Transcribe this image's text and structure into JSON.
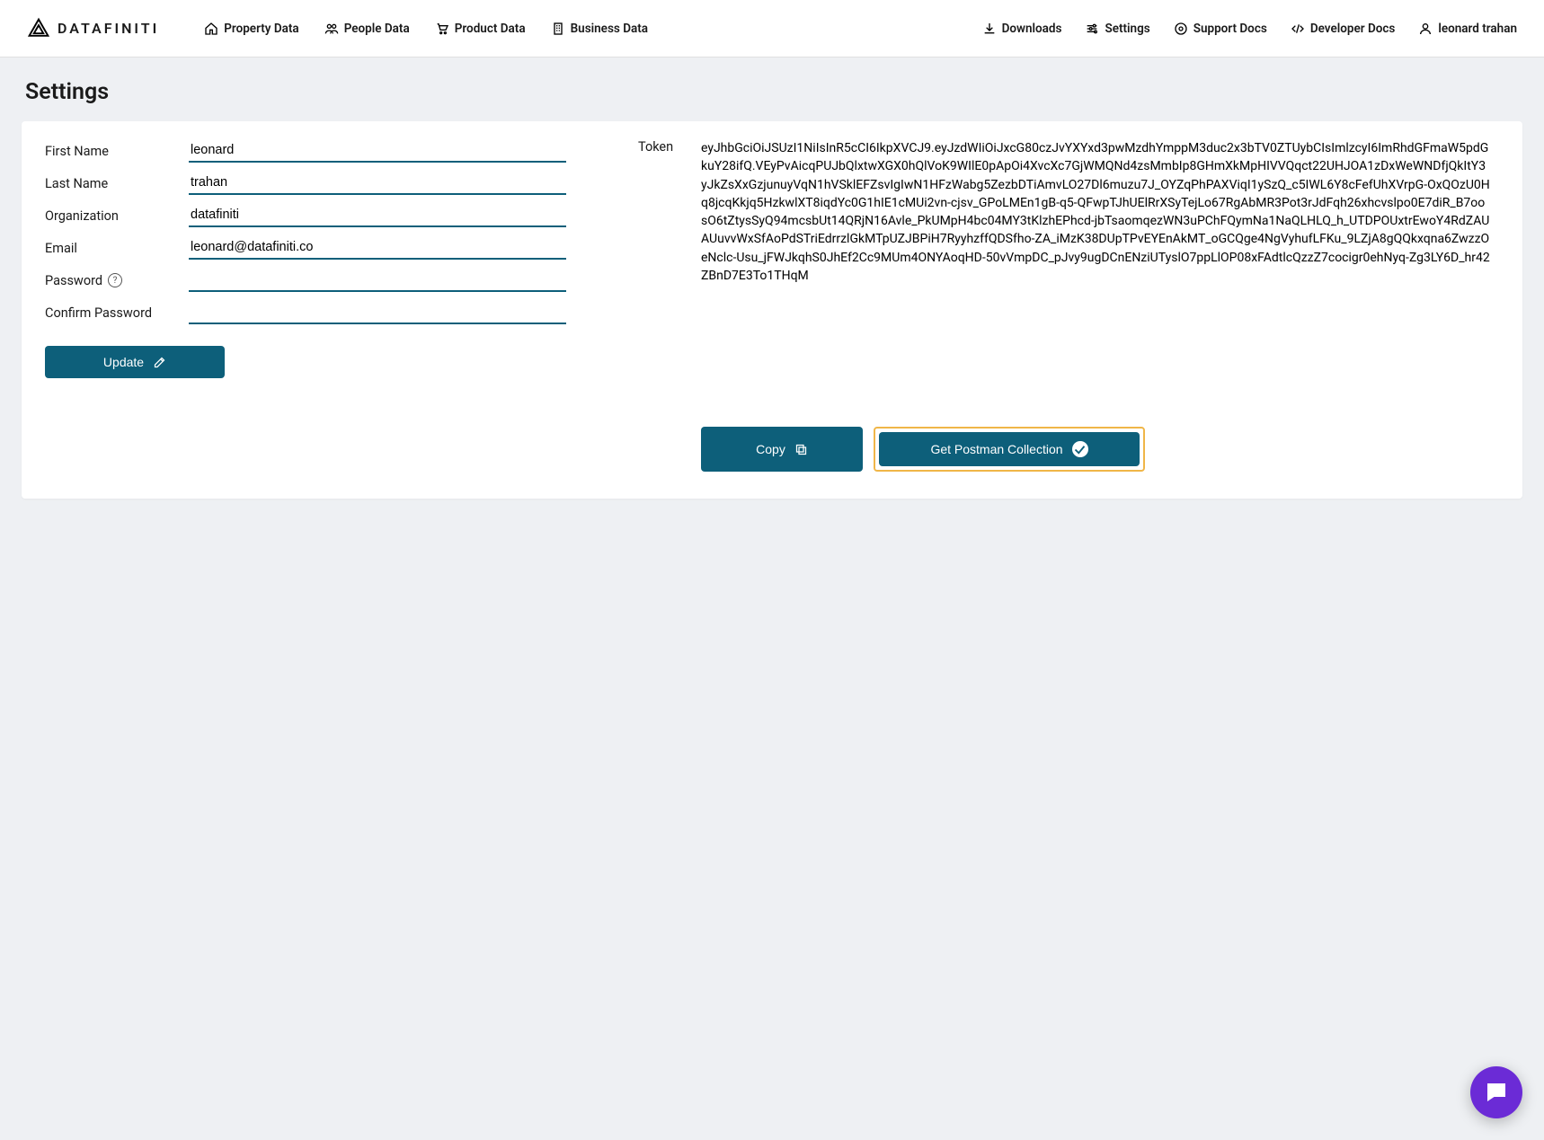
{
  "brand": "DATAFINITI",
  "nav": {
    "property": "Property Data",
    "people": "People Data",
    "product": "Product Data",
    "business": "Business Data",
    "downloads": "Downloads",
    "settings": "Settings",
    "support": "Support Docs",
    "developer": "Developer Docs",
    "user": "leonard trahan"
  },
  "page": {
    "title": "Settings"
  },
  "form": {
    "firstName": {
      "label": "First Name",
      "value": "leonard"
    },
    "lastName": {
      "label": "Last Name",
      "value": "trahan"
    },
    "organization": {
      "label": "Organization",
      "value": "datafiniti"
    },
    "email": {
      "label": "Email",
      "value": "leonard@datafiniti.co"
    },
    "password": {
      "label": "Password",
      "value": ""
    },
    "confirm": {
      "label": "Confirm Password",
      "value": ""
    },
    "updateLabel": "Update"
  },
  "token": {
    "label": "Token",
    "value": "eyJhbGciOiJSUzI1NiIsInR5cCI6IkpXVCJ9.eyJzdWIiOiJxcG80czJvYXYxd3pwMzdhYmppM3duc2x3bTV0ZTUybCIsImlzcyI6ImRhdGFmaW5pdGkuY28ifQ.VEyPvAicqPUJbQlxtwXGX0hQlVoK9WIlE0pApOi4XvcXc7GjWMQNd4zsMmbIp8GHmXkMpHIVVQqct22UHJOA1zDxWeWNDfjQkItY3yJkZsXxGzjunuyVqN1hVSklEFZsvIgIwN1HFzWabg5ZezbDTiAmvLO27Dl6muzu7J_OYZqPhPAXViqI1ySzQ_c5IWL6Y8cFefUhXVrpG-OxQOzU0Hq8jcqKkjq5HzkwlXT8iqdYc0G1hIE1cMUi2vn-cjsv_GPoLMEn1gB-q5-QFwpTJhUElRrXSyTejLo67RgAbMR3Pot3rJdFqh26xhcvslpo0E7diR_B7oosO6tZtysSyQ94mcsbUt14QRjN16Avle_PkUMpH4bc04MY3tKlzhEPhcd-jbTsaomqezWN3uPChFQymNa1NaQLHLQ_h_UTDPOUxtrEwoY4RdZAUAUuvvWxSfAoPdSTriEdrrzlGkMTpUZJBPiH7RyyhzffQDSfho-ZA_iMzK38DUpTPvEYEnAkMT_oGCQge4NgVyhufLFKu_9LZjA8gQQkxqna6ZwzzOeNclc-Usu_jFWJkqhS0JhEf2Cc9MUm4ONYAoqHD-50vVmpDC_pJvy9ugDCnENziUTyslO7ppLlOP08xFAdtlcQzzZ7cocigr0ehNyq-Zg3LY6D_hr42ZBnD7E3To1THqM",
    "copyLabel": "Copy",
    "postmanLabel": "Get Postman Collection"
  }
}
